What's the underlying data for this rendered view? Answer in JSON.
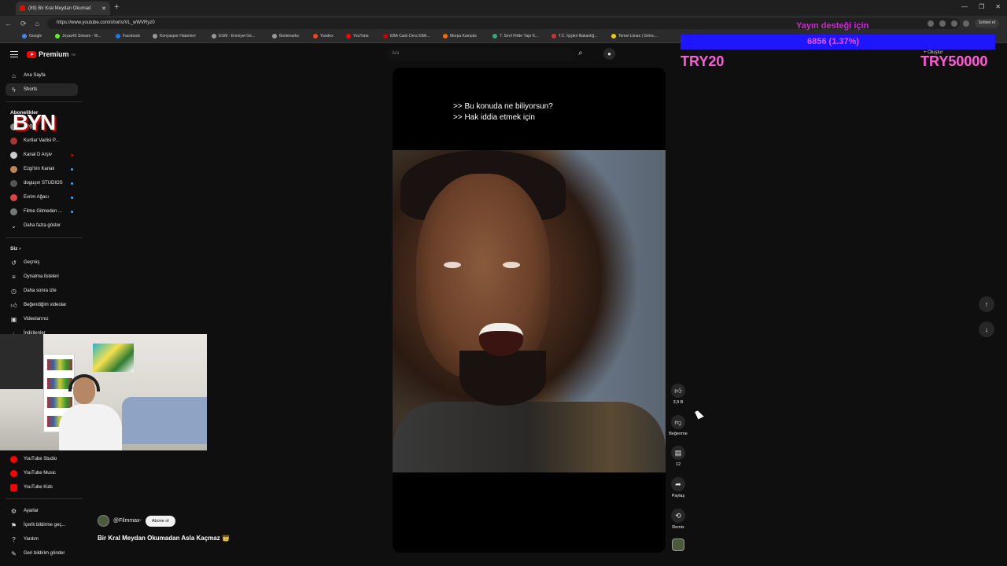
{
  "browser": {
    "tab_title": "(89) Bir Kral Meydan Okumad",
    "url": "https://www.youtube.com/shorts/VL_wWVRyz0",
    "chat_label": "Sohbet et",
    "bookmarks": [
      "Google",
      "Joyas42 Stream - W...",
      "Facebook",
      "Konyaspor Haberleri",
      "EGM - Emniyet Ge...",
      "Bookmarks",
      "Yandex",
      "YouTube",
      "EBA Canlı Ders EBA...",
      "Morpa Kampüs",
      "7. Sınıf Fiilde Yapı K...",
      "T.C. İçişleri Bakanlığ...",
      "Temel Liman | Gelec..."
    ]
  },
  "header": {
    "logo_text": "Premium",
    "logo_sup": "TR",
    "search_placeholder": "Ara",
    "create_label": "Oluştur"
  },
  "sidebar": {
    "home": "Ana Sayfa",
    "shorts": "Shorts",
    "subs_title": "Abonelikler",
    "subs": [
      "Doğa",
      "Kurtlar Vadisi P...",
      "Kanal D Arşiv",
      "Ezgi'nin Kanalı",
      "doguşın STUDIOS",
      "Evrim Ağacı",
      "Filme Gitmeden ..."
    ],
    "show_more": "Daha fazla göster",
    "you_title": "Siz",
    "you_items": [
      "Geçmiş",
      "Oynatma listeleri",
      "Daha sonra izle",
      "Beğendiğim videolar",
      "Videolarınız",
      "İndirilenler"
    ],
    "more_yt": [
      "YouTube Studio",
      "YouTube Music",
      "YouTube Kids"
    ],
    "settings": [
      "Ayarlar",
      "İçerik bildirme geç...",
      "Yardım",
      "Geri bildirim gönder"
    ]
  },
  "overlay_logo": "BYN",
  "video": {
    "subtitle_1": ">> Bu konuda ne biliyorsun?",
    "subtitle_2": ">> Hak iddia etmek için",
    "channel": "@Filmmax-",
    "subscribe": "Abone ol",
    "title": "Bir Kral Meydan Okumadan Asla Kaçmaz 👑"
  },
  "actions": {
    "likes": "3,9 B",
    "dislike": "Beğenme",
    "comments": "12",
    "share": "Paylaş",
    "remix": "Remix"
  },
  "stream_overlay": {
    "goal_title": "Yayın desteği için",
    "goal_progress": "6856 (1.37%)",
    "left_text": "TRY20",
    "right_text": "TRY50000"
  }
}
